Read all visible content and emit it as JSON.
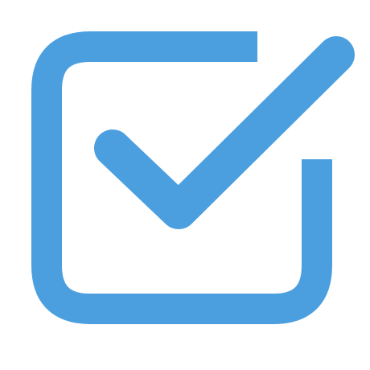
{
  "icon": {
    "name": "checkbox-checked-icon",
    "color": "#4b9fdf",
    "background": "#ffffff"
  }
}
